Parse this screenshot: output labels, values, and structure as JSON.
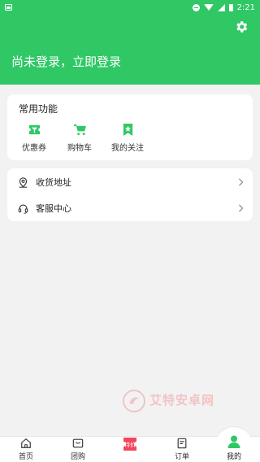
{
  "status_bar": {
    "time": "2:21"
  },
  "header": {
    "login_prompt": "尚未登录，立即登录"
  },
  "functions": {
    "title": "常用功能",
    "items": [
      {
        "label": "优惠券",
        "icon": "coupon-icon"
      },
      {
        "label": "购物车",
        "icon": "cart-icon"
      },
      {
        "label": "我的关注",
        "icon": "bookmark-star-icon"
      }
    ]
  },
  "links": [
    {
      "label": "收货地址",
      "icon": "location-pin-icon"
    },
    {
      "label": "客服中心",
      "icon": "headset-icon"
    }
  ],
  "watermark": {
    "text": "艾特安卓网"
  },
  "tabs": [
    {
      "label": "首页",
      "icon": "home-icon"
    },
    {
      "label": "团购",
      "icon": "group-buy-icon"
    },
    {
      "label": "特价",
      "icon": "special-offer-icon"
    },
    {
      "label": "订单",
      "icon": "order-icon"
    },
    {
      "label": "我的",
      "icon": "profile-icon",
      "active": true
    }
  ],
  "colors": {
    "accent": "#2fc865",
    "special_tab": "#f5455c",
    "background": "#f2f2f2"
  }
}
